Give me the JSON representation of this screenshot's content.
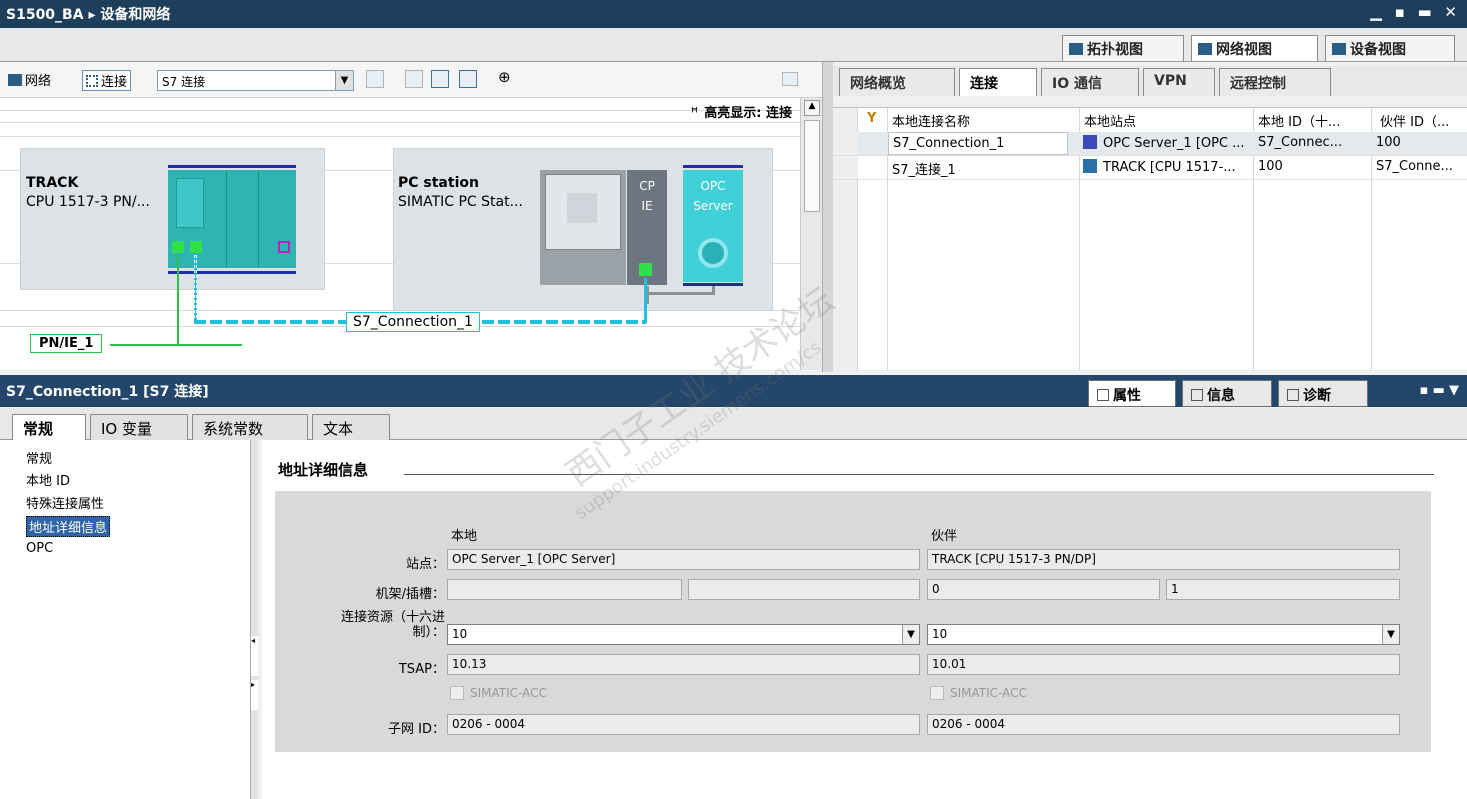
{
  "title": {
    "project": "S1500_BA",
    "separator": "▸",
    "page": "设备和网络",
    "controls": "▁ ▪ ▬ ✕"
  },
  "view_tabs": [
    "拓扑视图",
    "网络视图",
    "设备视图"
  ],
  "toolbar": {
    "network_label": "网络",
    "connect_label": "连接",
    "connection_type": "S7 连接",
    "zoom_symbol": "⊕",
    "highlight_label": "高亮显示: 连接"
  },
  "canvas": {
    "track": {
      "name": "TRACK",
      "cpu": "CPU 1517-3 PN/..."
    },
    "pc": {
      "name": "PC station",
      "sub": "SIMATIC PC Stat...",
      "cp1": "CP",
      "cp2": "IE",
      "opc1": "OPC",
      "opc2": "Server"
    },
    "connection_label": "S7_Connection_1",
    "subnet_label": "PN/IE_1"
  },
  "right_tabs": [
    "网络概览",
    "连接",
    "IO 通信",
    "VPN",
    "远程控制"
  ],
  "right_table": {
    "headers": [
      "本地连接名称",
      "本地站点",
      "本地 ID（十...",
      "伙伴 ID（..."
    ],
    "rows": [
      {
        "name": "S7_Connection_1",
        "station": "OPC Server_1 [OPC ...",
        "local_id": "S7_Connec...",
        "partner_id": "100"
      },
      {
        "name": "S7_连接_1",
        "station": "TRACK [CPU 1517-...",
        "local_id": "100",
        "partner_id": "S7_Conne..."
      }
    ]
  },
  "inspector": {
    "title": "S7_Connection_1 [S7 连接]",
    "tabs": [
      "属性",
      "信息",
      "诊断"
    ]
  },
  "prop_tabs": [
    "常规",
    "IO 变量",
    "系统常数",
    "文本"
  ],
  "nav_items": [
    "常规",
    "本地 ID",
    "特殊连接属性",
    "地址详细信息",
    "OPC"
  ],
  "section_title": "地址详细信息",
  "address": {
    "local_header": "本地",
    "partner_header": "伙伴",
    "station_label": "站点：",
    "rack_label": "机架/插槽：",
    "resource_label_1": "连接资源（十六进",
    "resource_label_2": "制）：",
    "tsap_label": "TSAP：",
    "subnet_label": "子网 ID：",
    "local_station": "OPC Server_1 [OPC Server]",
    "partner_station": "TRACK [CPU 1517-3 PN/DP]",
    "local_rack": "",
    "local_slot": "",
    "partner_rack": "0",
    "partner_slot": "1",
    "local_resource": "10",
    "partner_resource": "10",
    "local_tsap": "10.13",
    "partner_tsap": "10.01",
    "acc_label": "SIMATIC-ACC",
    "local_subnet": "0206 - 0004",
    "partner_subnet": "0206 - 0004"
  },
  "watermark": {
    "line1": "西门子工业 技术论坛",
    "line2": "support.industry.siemens.com/cs"
  },
  "colors": {
    "title_bg": "#1e3f5c",
    "device_teal": "#2fb3b3",
    "network_green": "#2ec04a",
    "select_blue": "#3064a8"
  }
}
